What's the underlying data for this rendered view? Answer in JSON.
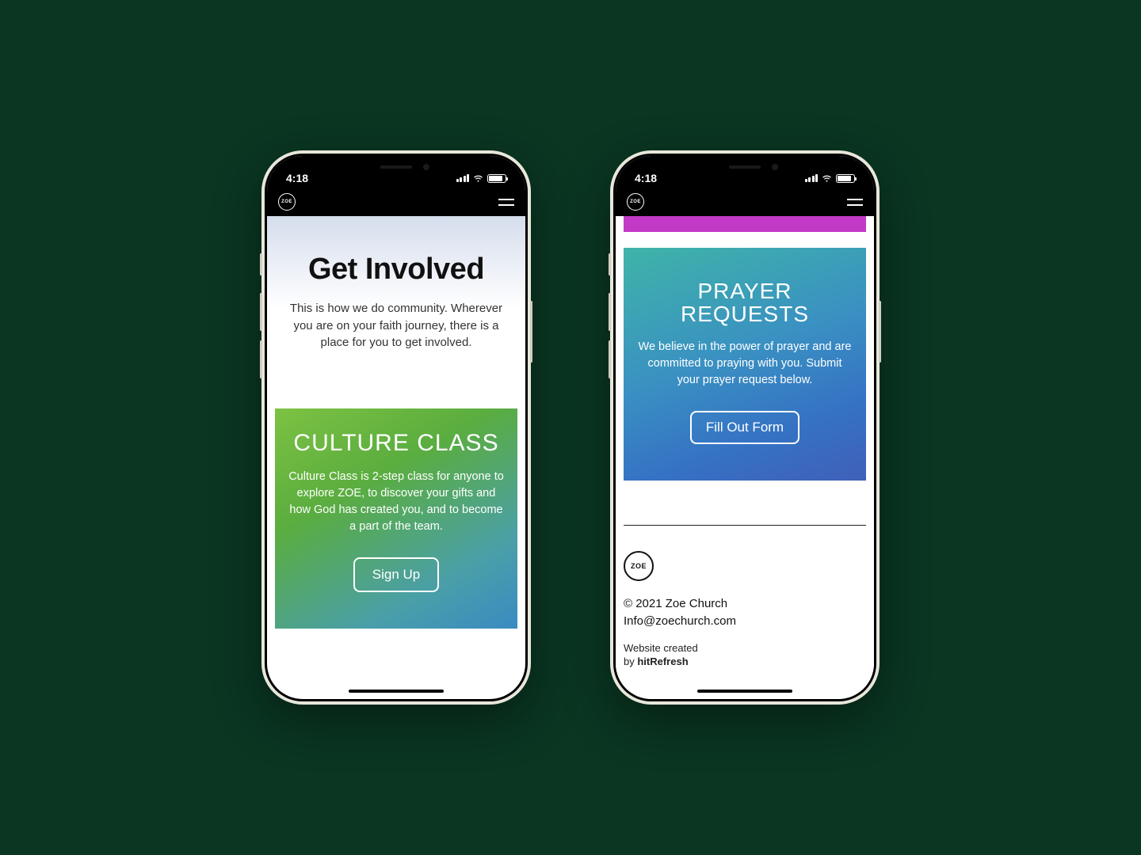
{
  "statusbar": {
    "time": "4:18"
  },
  "header": {
    "logo_text": "ZOE"
  },
  "phone1": {
    "hero": {
      "title": "Get Involved",
      "description": "This is how we do community. Wherever you are on your faith journey, there is a place for you to get involved."
    },
    "card": {
      "title": "CULTURE CLASS",
      "description": "Culture Class is 2-step class for anyone to explore ZOE, to discover your gifts and how God has created you, and to become a part of the team.",
      "button": "Sign Up"
    }
  },
  "phone2": {
    "card": {
      "title": "PRAYER REQUESTS",
      "description": "We believe in the power of prayer and are committed to praying with you. Submit your prayer request below.",
      "button": "Fill Out Form"
    },
    "footer": {
      "logo_text": "ZOE",
      "copyright": "© 2021 Zoe Church",
      "email": "Info@zoechurch.com",
      "credit_line1": "Website created",
      "credit_line2_prefix": "by ",
      "credit_line2_bold": "hitRefresh"
    }
  }
}
